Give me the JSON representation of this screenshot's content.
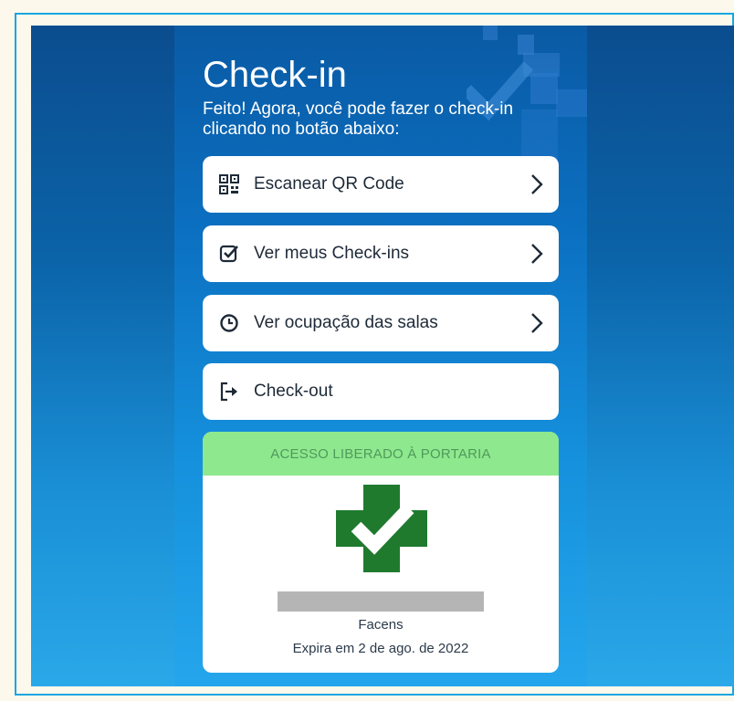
{
  "colors": {
    "accent": "#0b6fc0",
    "success_bg": "#8ee88e",
    "success_text": "#4f9a5b",
    "logo_green": "#1f7a2e"
  },
  "header": {
    "title": "Check-in",
    "subtitle": "Feito! Agora, você pode fazer o check-in clicando no botão abaixo:"
  },
  "menu": [
    {
      "label": "Escanear QR Code",
      "icon": "qr-code-icon",
      "chevron": true
    },
    {
      "label": "Ver meus Check-ins",
      "icon": "checkbox-icon",
      "chevron": true
    },
    {
      "label": "Ver ocupação das salas",
      "icon": "clock-icon",
      "chevron": true
    },
    {
      "label": "Check-out",
      "icon": "logout-icon",
      "chevron": false
    }
  ],
  "access_card": {
    "status": "ACESSO LIBERADO À PORTARIA",
    "organization": "Facens",
    "expiry": "Expira em 2 de ago. de 2022"
  }
}
